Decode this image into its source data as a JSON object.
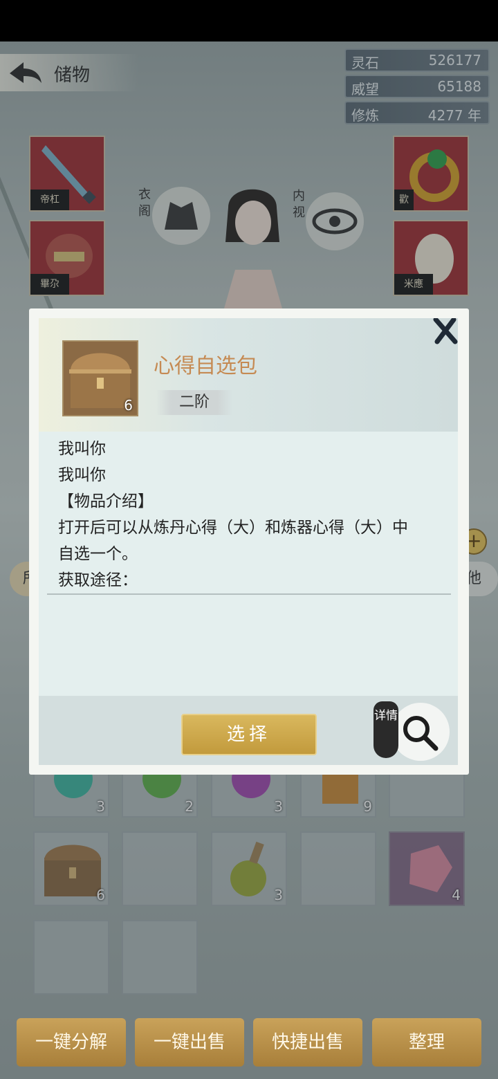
{
  "header": {
    "title": "储物"
  },
  "resources": [
    {
      "label": "灵石",
      "value": "526177"
    },
    {
      "label": "威望",
      "value": "65188"
    },
    {
      "label": "修炼",
      "value": "4277 年"
    }
  ],
  "side_buttons": {
    "wardrobe": "衣阁",
    "inner_view": "内视"
  },
  "equipment_tags": [
    "帝杠",
    "畢尕",
    "歡",
    "米應"
  ],
  "tabs": {
    "left_partial": "所",
    "right_partial": "他"
  },
  "modal": {
    "item_name": "心得自选包",
    "item_count": "6",
    "tier": "二阶",
    "desc_lines": [
      "我叫你",
      "我叫你",
      "【物品介绍】",
      "打开后可以从炼丹心得（大）和炼器心得（大）中",
      "自选一个。",
      "获取途径："
    ],
    "select_label": "选择",
    "detail_label": "详情"
  },
  "inventory": [
    {
      "count": "3",
      "color": "#3fb5a0"
    },
    {
      "count": "2",
      "color": "#5fb04a"
    },
    {
      "count": "3",
      "color": "#a24ab0"
    },
    {
      "count": "9",
      "color": "#c98a3a"
    },
    {
      "count": "",
      "color": ""
    },
    {
      "count": "6",
      "color": "#8b6a45"
    },
    {
      "count": "",
      "color": ""
    },
    {
      "count": "3",
      "color": "#9aa83c"
    },
    {
      "count": "",
      "color": ""
    },
    {
      "count": "4",
      "color": "#d98aa0"
    }
  ],
  "bottom_bar": {
    "decompose": "一键分解",
    "sell_all": "一键出售",
    "quick_sell": "快捷出售",
    "arrange": "整理"
  }
}
